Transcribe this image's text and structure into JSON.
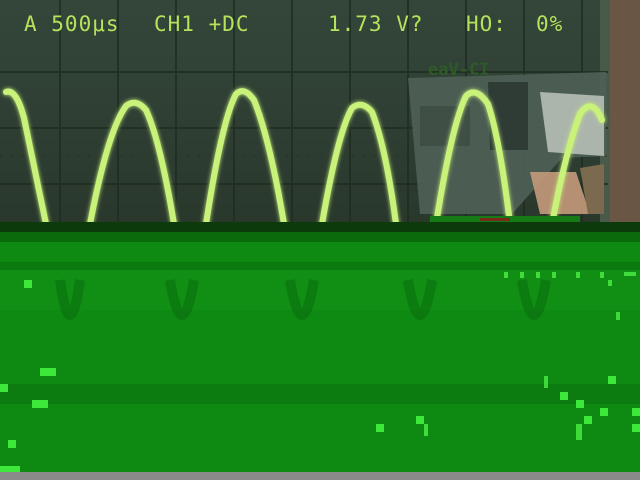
{
  "screen": {
    "timebase": "A 500μs",
    "channel": "CH1 +DC",
    "voltage": "1.73 V?",
    "holdoff": "HO:",
    "holdoff_value": "0%",
    "overlay_label": "eaV-CI"
  },
  "colors": {
    "screen_bg": "#2a3a2a",
    "grid": "#1e2a1e",
    "trace": "#c8f27a",
    "text": "#b6e25c",
    "lower_green": "#0e8a12",
    "lower_bright": "#22b01c",
    "bottom_bar": "#8a8a8a"
  }
}
